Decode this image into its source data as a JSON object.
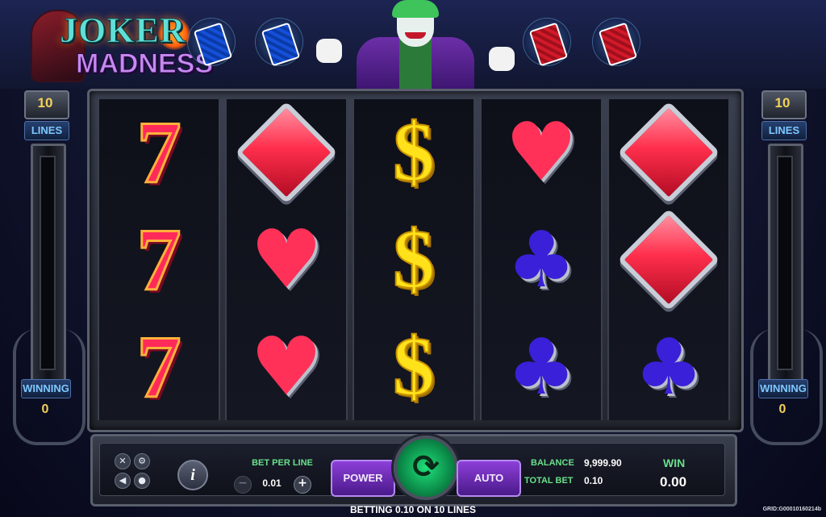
{
  "game": {
    "logo_line1": "JOKER",
    "logo_line2": "MADNESS"
  },
  "left_panel": {
    "lines_count": "10",
    "lines_label": "LINES",
    "winning_label": "WINNING",
    "winning_value": "0"
  },
  "right_panel": {
    "lines_count": "10",
    "lines_label": "LINES",
    "winning_label": "WINNING",
    "winning_value": "0"
  },
  "reels": [
    [
      "seven",
      "seven",
      "seven"
    ],
    [
      "diamond",
      "heart",
      "heart"
    ],
    [
      "dollar",
      "dollar",
      "dollar"
    ],
    [
      "heart",
      "club",
      "club"
    ],
    [
      "diamond",
      "diamond",
      "club"
    ]
  ],
  "symbols": {
    "seven": "7",
    "dollar": "$",
    "heart": "♥",
    "club": "♣",
    "diamond": ""
  },
  "controls": {
    "info_label": "i",
    "bet_per_line_label": "BET PER LINE",
    "bet_per_line_value": "0.01",
    "minus_label": "−",
    "plus_label": "+",
    "power_label": "POWER",
    "auto_label": "AUTO",
    "spin_icon": "⟳",
    "balance_label": "BALANCE",
    "balance_value": "9,999.90",
    "total_bet_label": "TOTAL BET",
    "total_bet_value": "0.10",
    "win_label": "WIN",
    "win_value": "0.00",
    "fullscreen_icon": "✕",
    "settings_icon": "⚙",
    "sound_icon": "◀",
    "history_icon": "●"
  },
  "footer": {
    "betting_text": "BETTING 0.10 ON 10 LINES",
    "grid_id": "GRID:G00010160214b"
  },
  "colors": {
    "accent_green": "#69e08a",
    "spin_green": "#20e07a",
    "button_purple": "#8d3fd8"
  }
}
